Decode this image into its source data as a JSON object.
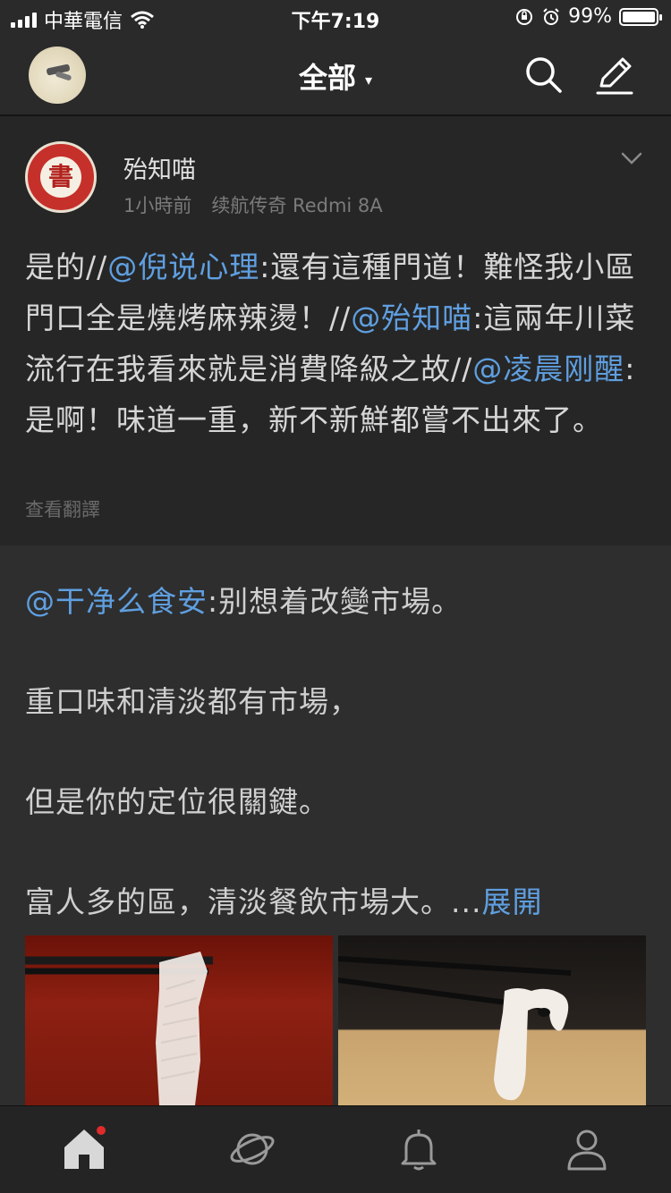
{
  "status_bar": {
    "carrier": "中華電信",
    "time": "下午7:19",
    "battery_percent": "99%",
    "battery_level": 0.99,
    "icons": [
      "signal-icon",
      "wifi-icon",
      "rotation-lock-icon",
      "alarm-icon",
      "battery-icon"
    ]
  },
  "nav": {
    "title": "全部",
    "caret": "▾",
    "icons": [
      "avatar",
      "search-icon",
      "edit-icon"
    ]
  },
  "post": {
    "author": "殆知喵",
    "time_ago": "1小時前",
    "device": "续航传奇 Redmi 8A",
    "body": {
      "p1": "是的//",
      "m1": "@倪说心理",
      "p2": ":還有這種門道！難怪我小區門口全是燒烤麻辣燙！//",
      "m2": "@殆知喵",
      "p3": ":這兩年川菜流行在我看來就是消費降級之故//",
      "m3": "@凌晨刚醒",
      "p4": ":是啊！味道一重，新不新鮮都嘗不出來了。"
    },
    "translate_label": "查看翻譯"
  },
  "retweet": {
    "mention": "@干净么食安",
    "line1_rest": ":别想着改變市場。",
    "line2": "重口味和清淡都有市場，",
    "line3": "但是你的定位很關鍵。",
    "line4": "富人多的區，清淡餐飲市場大。...",
    "expand_label": "展開",
    "photos": [
      "chopsticks-tripe-photo",
      "chopsticks-tripe-photo-2"
    ]
  },
  "tabbar": {
    "items": [
      "home-icon",
      "explore-icon",
      "notification-icon",
      "profile-icon"
    ],
    "home_has_badge": true
  },
  "colors": {
    "background": "#1f1f1f",
    "header": "#2a2a2a",
    "mention": "#5f9fe0",
    "badge": "#e02b2b"
  }
}
